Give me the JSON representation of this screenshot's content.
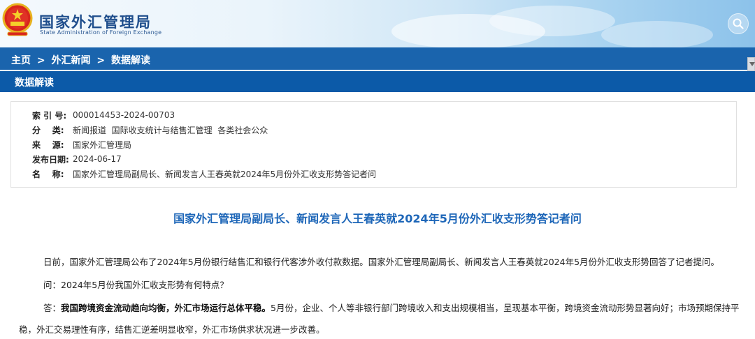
{
  "header": {
    "site_title": "国家外汇管理局",
    "site_subtitle": "State Administration of Foreign Exchange",
    "search_icon": "search-icon",
    "emblem_icon": "national-emblem-icon"
  },
  "breadcrumb": {
    "items": [
      "主页",
      "外汇新闻",
      "数据解读"
    ],
    "separator": ">"
  },
  "section": {
    "title": "数据解读"
  },
  "meta": {
    "index_label": "索 引 号:",
    "index_value": "000014453-2024-00703",
    "category_label": "分    类:",
    "category_value": "新闻报道  国际收支统计与结售汇管理  各类社会公众",
    "source_label": "来    源:",
    "source_value": "国家外汇管理局",
    "date_label": "发布日期:",
    "date_value": "2024-06-17",
    "name_label": "名    称:",
    "name_value": "国家外汇管理局副局长、新闻发言人王春英就2024年5月份外汇收支形势答记者问"
  },
  "article": {
    "title": "国家外汇管理局副局长、新闻发言人王春英就2024年5月份外汇收支形势答记者问",
    "intro": "日前，国家外汇管理局公布了2024年5月份银行结售汇和银行代客涉外收付款数据。国家外汇管理局副局长、新闻发言人王春英就2024年5月份外汇收支形势回答了记者提问。",
    "question": "问：2024年5月份我国外汇收支形势有何特点？",
    "answer_prefix": "答：",
    "answer_bold": "我国跨境资金流动趋向均衡，外汇市场运行总体平稳。",
    "answer_rest": "5月份，企业、个人等非银行部门跨境收入和支出规模相当，呈现基本平衡，跨境资金流动形势显著向好；市场预期保持平",
    "answer_line2": "稳，外汇交易理性有序，结售汇逆差明显收窄，外汇市场供求状况进一步改善。"
  },
  "colors": {
    "section_bar": "#0c5aa8",
    "breadcrumb_bar": "#1a64ad",
    "title_blue": "#1d66b8"
  }
}
